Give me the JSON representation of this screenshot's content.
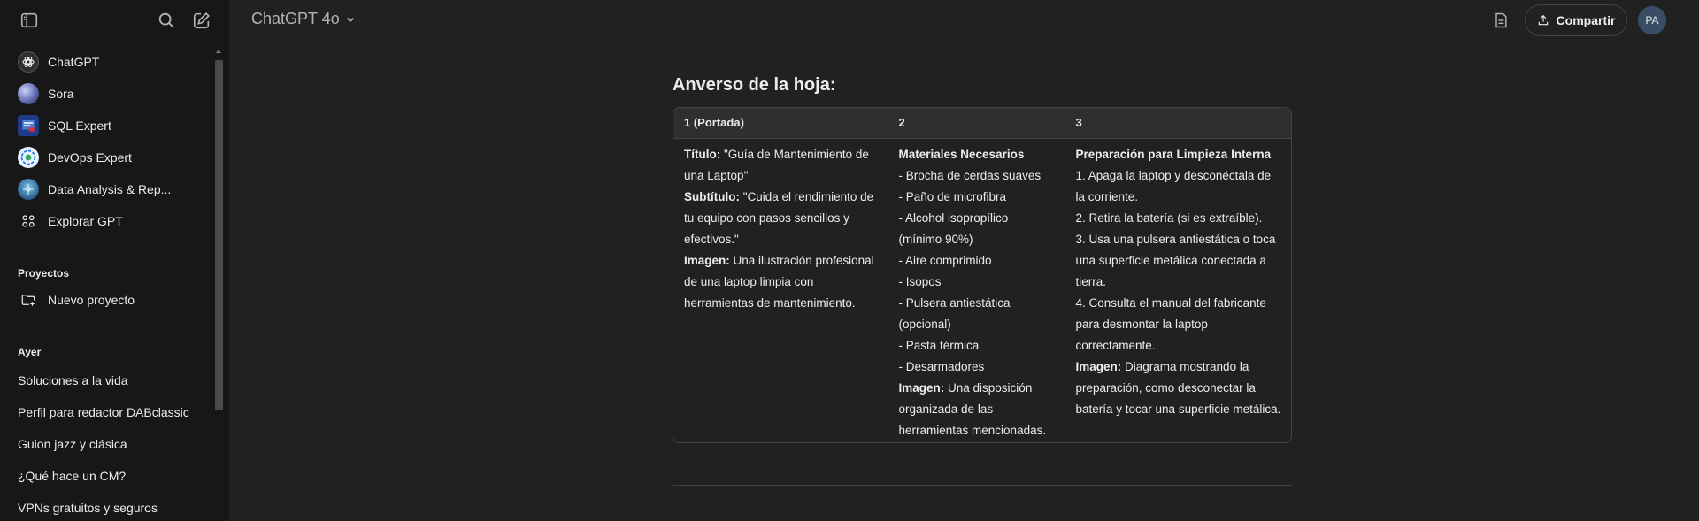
{
  "sidebar": {
    "gpts": [
      {
        "label": "ChatGPT",
        "icon": "chatgpt-logo-icon"
      },
      {
        "label": "Sora",
        "icon": "sora-icon"
      },
      {
        "label": "SQL Expert",
        "icon": "sql-expert-icon"
      },
      {
        "label": "DevOps Expert",
        "icon": "devops-expert-icon"
      },
      {
        "label": "Data Analysis & Rep...",
        "icon": "data-analysis-icon"
      },
      {
        "label": "Explorar GPT",
        "icon": "grid-icon"
      }
    ],
    "projects_title": "Proyectos",
    "new_project_label": "Nuevo proyecto",
    "history_title": "Ayer",
    "history": [
      "Soluciones a la vida",
      "Perfil para redactor DABclassic",
      "Guion jazz y clásica",
      "¿Qué hace un CM?",
      "VPNs gratuitos y seguros"
    ]
  },
  "header": {
    "model_name": "ChatGPT 4o",
    "share_label": "Compartir",
    "user_initials": "PA"
  },
  "main": {
    "heading": "Anverso de la hoja:",
    "table": {
      "headers": [
        "1 (Portada)",
        "2",
        "3"
      ],
      "col1": [
        {
          "b": "Título:",
          "t": " \"Guía de Mantenimiento de una Laptop\""
        },
        {
          "b": "Subtítulo:",
          "t": " \"Cuida el rendimiento de tu equipo con pasos sencillos y efectivos.\""
        },
        {
          "b": "Imagen:",
          "t": " Una ilustración profesional de una laptop limpia con herramientas de mantenimiento."
        }
      ],
      "col2": [
        {
          "b": "Materiales Necesarios",
          "t": ""
        },
        {
          "b": "",
          "t": "- Brocha de cerdas suaves"
        },
        {
          "b": "",
          "t": "- Paño de microfibra"
        },
        {
          "b": "",
          "t": "- Alcohol isopropílico (mínimo 90%)"
        },
        {
          "b": "",
          "t": "- Aire comprimido"
        },
        {
          "b": "",
          "t": "- Isopos"
        },
        {
          "b": "",
          "t": "- Pulsera antiestática (opcional)"
        },
        {
          "b": "",
          "t": "- Pasta térmica"
        },
        {
          "b": "",
          "t": "- Desarmadores"
        },
        {
          "b": "Imagen:",
          "t": " Una disposición organizada de las herramientas mencionadas."
        }
      ],
      "col3": [
        {
          "b": "Preparación para Limpieza Interna",
          "t": ""
        },
        {
          "b": "",
          "t": "1. Apaga la laptop y desconéctala de la corriente."
        },
        {
          "b": "",
          "t": "2. Retira la batería (si es extraíble)."
        },
        {
          "b": "",
          "t": "3. Usa una pulsera antiestática o toca una superficie metálica conectada a tierra."
        },
        {
          "b": "",
          "t": "4. Consulta el manual del fabricante para desmontar la laptop correctamente."
        },
        {
          "b": "Imagen:",
          "t": " Diagrama mostrando la preparación, como desconectar la batería y tocar una superficie metálica."
        }
      ]
    }
  },
  "colors": {
    "background": "#212121",
    "sidebar": "#171717",
    "text": "#ececec",
    "muted": "#b4b4b4",
    "border": "#424242",
    "avatar": "#3a4d66"
  }
}
